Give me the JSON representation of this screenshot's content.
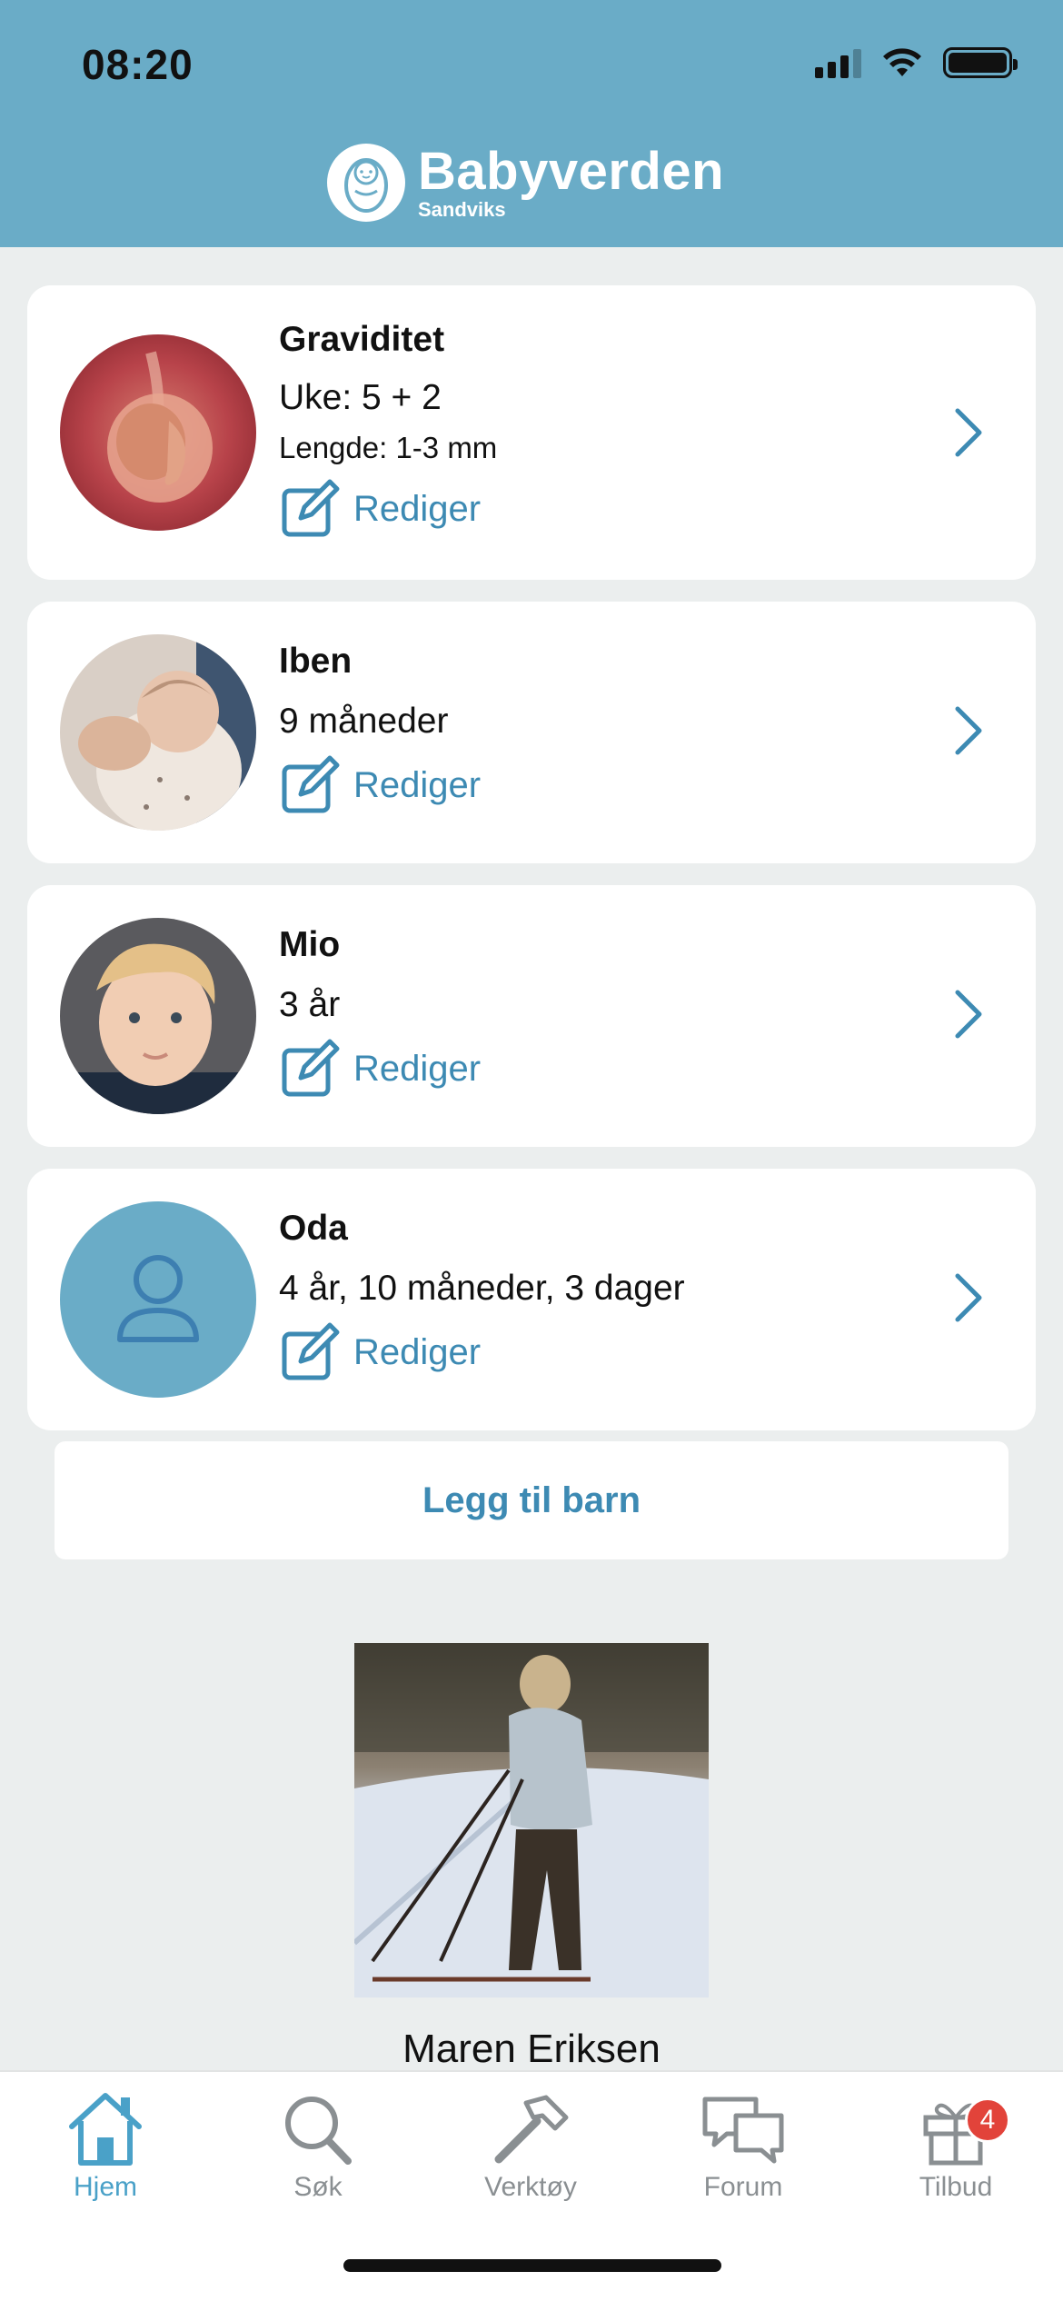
{
  "status_bar": {
    "time": "08:20"
  },
  "header": {
    "title": "Babyverden",
    "subtitle": "Sandviks"
  },
  "cards": [
    {
      "name": "Graviditet",
      "line1": "Uke: 5 + 2",
      "line2": "Lengde: 1-3 mm",
      "edit_label": "Rediger"
    },
    {
      "name": "Iben",
      "line1": "9 måneder",
      "edit_label": "Rediger"
    },
    {
      "name": "Mio",
      "line1": "3 år",
      "edit_label": "Rediger"
    },
    {
      "name": "Oda",
      "line1": "4 år, 10 måneder, 3 dager",
      "edit_label": "Rediger"
    }
  ],
  "add_child_label": "Legg til barn",
  "feature": {
    "name": "Maren Eriksen"
  },
  "tabs": [
    {
      "label": "Hjem",
      "icon": "home-icon",
      "active": true
    },
    {
      "label": "Søk",
      "icon": "search-icon"
    },
    {
      "label": "Verktøy",
      "icon": "hammer-icon"
    },
    {
      "label": "Forum",
      "icon": "chat-icon"
    },
    {
      "label": "Tilbud",
      "icon": "gift-icon",
      "badge": "4"
    }
  ],
  "colors": {
    "header": "#6aacc7",
    "accent": "#3d8ab3",
    "active_tab": "#4aa1c8",
    "badge": "#e2433a"
  }
}
